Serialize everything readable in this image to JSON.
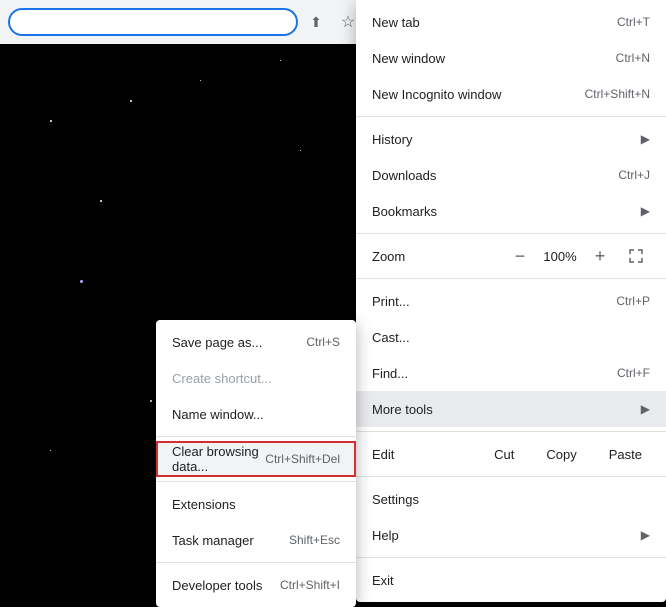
{
  "toolbar": {
    "share_icon": "⬆",
    "star_icon": "☆"
  },
  "main_menu": {
    "items": [
      {
        "id": "new-tab",
        "label": "New tab",
        "shortcut": "Ctrl+T",
        "has_arrow": false
      },
      {
        "id": "new-window",
        "label": "New window",
        "shortcut": "Ctrl+N",
        "has_arrow": false
      },
      {
        "id": "new-incognito",
        "label": "New Incognito window",
        "shortcut": "Ctrl+Shift+N",
        "has_arrow": false
      },
      {
        "id": "history",
        "label": "History",
        "shortcut": "",
        "has_arrow": true
      },
      {
        "id": "downloads",
        "label": "Downloads",
        "shortcut": "Ctrl+J",
        "has_arrow": false
      },
      {
        "id": "bookmarks",
        "label": "Bookmarks",
        "shortcut": "",
        "has_arrow": true
      },
      {
        "id": "zoom-label",
        "label": "Zoom",
        "shortcut": "",
        "has_arrow": false,
        "is_zoom": true,
        "zoom_value": "100%",
        "zoom_minus": "−",
        "zoom_plus": "+"
      },
      {
        "id": "print",
        "label": "Print...",
        "shortcut": "Ctrl+P",
        "has_arrow": false
      },
      {
        "id": "cast",
        "label": "Cast...",
        "shortcut": "",
        "has_arrow": false
      },
      {
        "id": "find",
        "label": "Find...",
        "shortcut": "Ctrl+F",
        "has_arrow": false
      },
      {
        "id": "more-tools",
        "label": "More tools",
        "shortcut": "",
        "has_arrow": true,
        "is_highlighted": true
      },
      {
        "id": "settings",
        "label": "Settings",
        "shortcut": "",
        "has_arrow": false
      },
      {
        "id": "help",
        "label": "Help",
        "shortcut": "",
        "has_arrow": true
      },
      {
        "id": "exit",
        "label": "Exit",
        "shortcut": "",
        "has_arrow": false
      }
    ],
    "edit_row": {
      "edit_label": "Edit",
      "cut_label": "Cut",
      "copy_label": "Copy",
      "paste_label": "Paste"
    }
  },
  "submenu": {
    "items": [
      {
        "id": "save-page",
        "label": "Save page as...",
        "shortcut": "Ctrl+S"
      },
      {
        "id": "create-shortcut",
        "label": "Create shortcut...",
        "shortcut": "",
        "disabled": true
      },
      {
        "id": "name-window",
        "label": "Name window...",
        "shortcut": "",
        "disabled": false
      },
      {
        "id": "clear-browsing",
        "label": "Clear browsing data...",
        "shortcut": "Ctrl+Shift+Del",
        "highlighted": true
      },
      {
        "id": "extensions",
        "label": "Extensions",
        "shortcut": ""
      },
      {
        "id": "task-manager",
        "label": "Task manager",
        "shortcut": "Shift+Esc"
      },
      {
        "id": "developer-tools",
        "label": "Developer tools",
        "shortcut": "Ctrl+Shift+I"
      }
    ]
  }
}
